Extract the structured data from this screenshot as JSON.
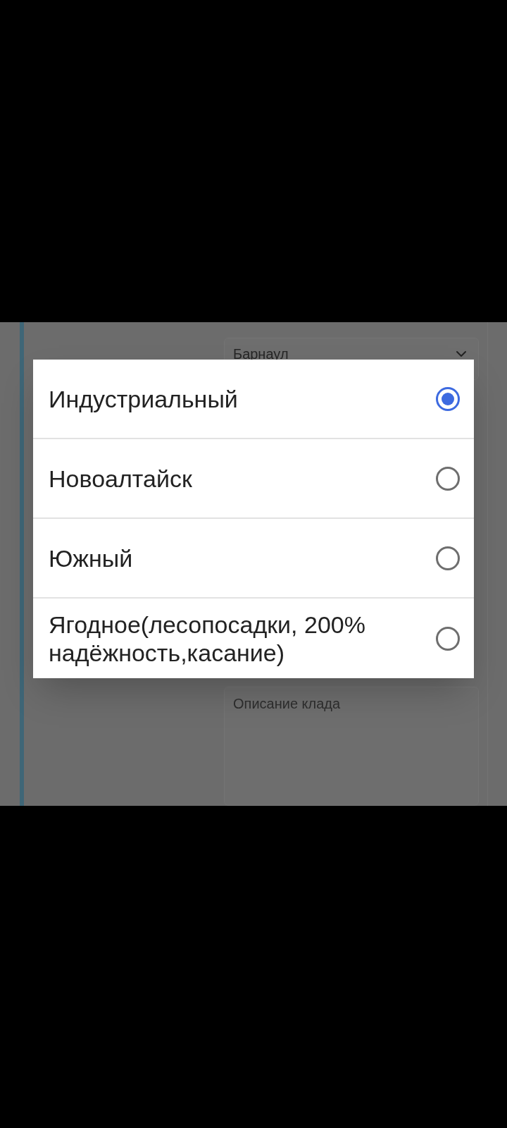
{
  "form": {
    "city_select": {
      "value": "Барнаул"
    },
    "description_field": {
      "placeholder": "Описание клада"
    }
  },
  "dialog": {
    "options": [
      {
        "label": "Индустриальный",
        "selected": true
      },
      {
        "label": "Новоалтайск",
        "selected": false
      },
      {
        "label": "Южный",
        "selected": false
      },
      {
        "label": "Ягодное(лесопосадки, 200% надёжность,касание)",
        "selected": false
      }
    ]
  }
}
